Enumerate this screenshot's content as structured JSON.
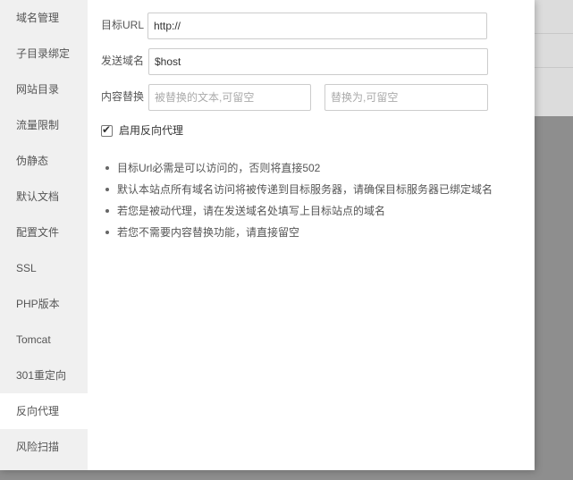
{
  "sidebar": {
    "items": [
      {
        "label": "域名管理"
      },
      {
        "label": "子目录绑定"
      },
      {
        "label": "网站目录"
      },
      {
        "label": "流量限制"
      },
      {
        "label": "伪静态"
      },
      {
        "label": "默认文档"
      },
      {
        "label": "配置文件"
      },
      {
        "label": "SSL"
      },
      {
        "label": "PHP版本"
      },
      {
        "label": "Tomcat"
      },
      {
        "label": "301重定向"
      },
      {
        "label": "反向代理"
      },
      {
        "label": "风险扫描"
      }
    ],
    "active_index": 11
  },
  "form": {
    "target_url": {
      "label": "目标URL",
      "value": "http://"
    },
    "send_domain": {
      "label": "发送域名",
      "value": "$host"
    },
    "content_replace": {
      "label": "内容替换",
      "from_placeholder": "被替换的文本,可留空",
      "to_placeholder": "替换为,可留空"
    },
    "enable_proxy": {
      "label": "启用反向代理",
      "checked": true
    }
  },
  "tips": [
    "目标Url必需是可以访问的，否则将直接502",
    "默认本站点所有域名访问将被传递到目标服务器，请确保目标服务器已绑定域名",
    "若您是被动代理，请在发送域名处填写上目标站点的域名",
    "若您不需要内容替换功能，请直接留空"
  ]
}
